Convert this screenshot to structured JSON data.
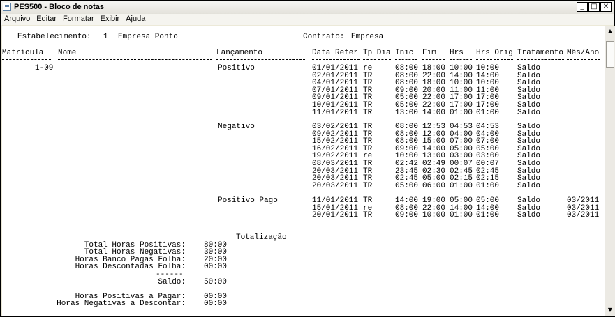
{
  "window": {
    "title": "PES500 - Bloco de notas",
    "controls": {
      "minimize": "_",
      "maximize": "□",
      "close": "✕"
    }
  },
  "menu": [
    "Arquivo",
    "Editar",
    "Formatar",
    "Exibir",
    "Ajuda"
  ],
  "report": {
    "header": {
      "estabelecimento_label": "Estabelecimento:",
      "estabelecimento_code": "1",
      "estabelecimento_name": "Empresa Ponto",
      "contrato_label": "Contrato:",
      "contrato_value": "Empresa"
    },
    "columns": {
      "matricula": "Matrícula",
      "nome": "Nome",
      "lancamento": "Lançamento",
      "data_refer": "Data Refer",
      "tp_dia": "Tp Dia",
      "inic": "Inic",
      "fim": "Fim",
      "hrs": "Hrs",
      "hrs_orig": "Hrs Orig",
      "tratamento": "Tratamento",
      "mes_ano": "Mês/Ano"
    },
    "matricula": "1-09",
    "groups": [
      {
        "lancamento": "Positivo",
        "rows": [
          {
            "data": "01/01/2011",
            "tp": "re",
            "inic": "08:00",
            "fim": "18:00",
            "hrs": "10:00",
            "orig": "10:00",
            "trat": "Saldo",
            "mes": ""
          },
          {
            "data": "02/01/2011",
            "tp": "TR",
            "inic": "08:00",
            "fim": "22:00",
            "hrs": "14:00",
            "orig": "14:00",
            "trat": "Saldo",
            "mes": ""
          },
          {
            "data": "04/01/2011",
            "tp": "TR",
            "inic": "08:00",
            "fim": "18:00",
            "hrs": "10:00",
            "orig": "10:00",
            "trat": "Saldo",
            "mes": ""
          },
          {
            "data": "07/01/2011",
            "tp": "TR",
            "inic": "09:00",
            "fim": "20:00",
            "hrs": "11:00",
            "orig": "11:00",
            "trat": "Saldo",
            "mes": ""
          },
          {
            "data": "09/01/2011",
            "tp": "TR",
            "inic": "05:00",
            "fim": "22:00",
            "hrs": "17:00",
            "orig": "17:00",
            "trat": "Saldo",
            "mes": ""
          },
          {
            "data": "10/01/2011",
            "tp": "TR",
            "inic": "05:00",
            "fim": "22:00",
            "hrs": "17:00",
            "orig": "17:00",
            "trat": "Saldo",
            "mes": ""
          },
          {
            "data": "11/01/2011",
            "tp": "TR",
            "inic": "13:00",
            "fim": "14:00",
            "hrs": "01:00",
            "orig": "01:00",
            "trat": "Saldo",
            "mes": ""
          }
        ]
      },
      {
        "lancamento": "Negativo",
        "rows": [
          {
            "data": "03/02/2011",
            "tp": "TR",
            "inic": "08:00",
            "fim": "12:53",
            "hrs": "04:53",
            "orig": "04:53",
            "trat": "Saldo",
            "mes": ""
          },
          {
            "data": "09/02/2011",
            "tp": "TR",
            "inic": "08:00",
            "fim": "12:00",
            "hrs": "04:00",
            "orig": "04:00",
            "trat": "Saldo",
            "mes": ""
          },
          {
            "data": "15/02/2011",
            "tp": "TR",
            "inic": "08:00",
            "fim": "15:00",
            "hrs": "07:00",
            "orig": "07:00",
            "trat": "Saldo",
            "mes": ""
          },
          {
            "data": "16/02/2011",
            "tp": "TR",
            "inic": "09:00",
            "fim": "14:00",
            "hrs": "05:00",
            "orig": "05:00",
            "trat": "Saldo",
            "mes": ""
          },
          {
            "data": "19/02/2011",
            "tp": "re",
            "inic": "10:00",
            "fim": "13:00",
            "hrs": "03:00",
            "orig": "03:00",
            "trat": "Saldo",
            "mes": ""
          },
          {
            "data": "08/03/2011",
            "tp": "TR",
            "inic": "02:42",
            "fim": "02:49",
            "hrs": "00:07",
            "orig": "00:07",
            "trat": "Saldo",
            "mes": ""
          },
          {
            "data": "20/03/2011",
            "tp": "TR",
            "inic": "23:45",
            "fim": "02:30",
            "hrs": "02:45",
            "orig": "02:45",
            "trat": "Saldo",
            "mes": ""
          },
          {
            "data": "20/03/2011",
            "tp": "TR",
            "inic": "02:45",
            "fim": "05:00",
            "hrs": "02:15",
            "orig": "02:15",
            "trat": "Saldo",
            "mes": ""
          },
          {
            "data": "20/03/2011",
            "tp": "TR",
            "inic": "05:00",
            "fim": "06:00",
            "hrs": "01:00",
            "orig": "01:00",
            "trat": "Saldo",
            "mes": ""
          }
        ]
      },
      {
        "lancamento": "Positivo Pago",
        "rows": [
          {
            "data": "11/01/2011",
            "tp": "TR",
            "inic": "14:00",
            "fim": "19:00",
            "hrs": "05:00",
            "orig": "05:00",
            "trat": "Saldo",
            "mes": "03/2011"
          },
          {
            "data": "15/01/2011",
            "tp": "re",
            "inic": "08:00",
            "fim": "22:00",
            "hrs": "14:00",
            "orig": "14:00",
            "trat": "Saldo",
            "mes": "03/2011"
          },
          {
            "data": "20/01/2011",
            "tp": "TR",
            "inic": "09:00",
            "fim": "10:00",
            "hrs": "01:00",
            "orig": "01:00",
            "trat": "Saldo",
            "mes": "03/2011"
          }
        ]
      }
    ],
    "totals": {
      "heading": "Totalização",
      "items": [
        {
          "label": "Total Horas Positivas:",
          "value": "80:00"
        },
        {
          "label": "Total Horas Negativas:",
          "value": "30:00"
        },
        {
          "label": "Horas Banco Pagas Folha:",
          "value": "20:00"
        },
        {
          "label": "Horas Descontadas Folha:",
          "value": "00:00"
        }
      ],
      "separator": "------",
      "saldo_label": "Saldo:",
      "saldo_value": "50:00",
      "pagar_label": "Horas Positivas a Pagar:",
      "pagar_value": "00:00",
      "descontar_label": "Horas Negativas a Descontar:",
      "descontar_value": "00:00"
    }
  }
}
